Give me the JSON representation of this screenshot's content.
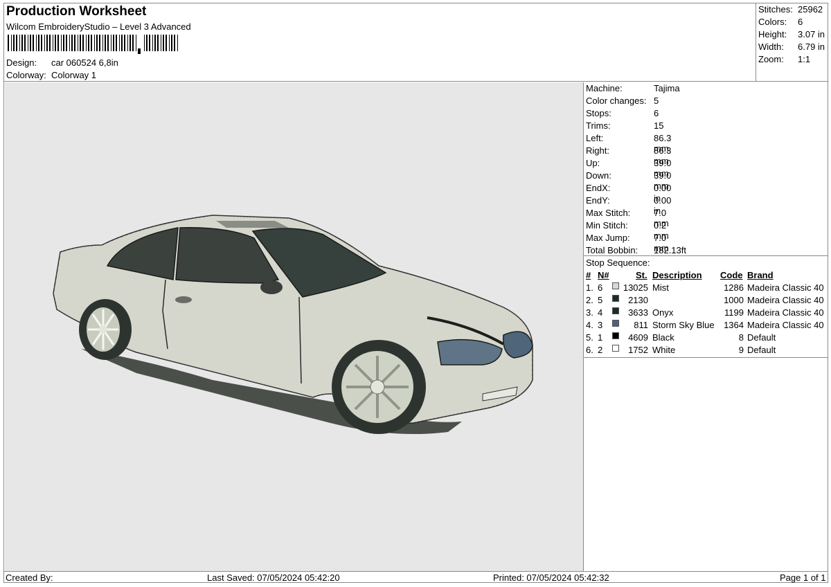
{
  "header": {
    "title": "Production Worksheet",
    "subtitle": "Wilcom EmbroideryStudio – Level 3 Advanced",
    "design_label": "Design:",
    "design_value": "car 060524 6,8in",
    "colorway_label": "Colorway:",
    "colorway_value": "Colorway 1"
  },
  "stats": {
    "stitches_label": "Stitches:",
    "stitches": "25962",
    "colors_label": "Colors:",
    "colors": "6",
    "height_label": "Height:",
    "height": "3.07 in",
    "width_label": "Width:",
    "width": "6.79 in",
    "zoom_label": "Zoom:",
    "zoom": "1:1"
  },
  "machine_info": [
    {
      "label": "Machine:",
      "value": "Tajima"
    },
    {
      "label": "Color changes:",
      "value": "5"
    },
    {
      "label": "Stops:",
      "value": "6"
    },
    {
      "label": "Trims:",
      "value": "15"
    },
    {
      "label": "Left:",
      "value": "86.3 mm"
    },
    {
      "label": "Right:",
      "value": "86.3 mm"
    },
    {
      "label": "Up:",
      "value": "39.0 mm"
    },
    {
      "label": "Down:",
      "value": "39.0 mm"
    },
    {
      "label": "EndX:",
      "value": "0.00 in"
    },
    {
      "label": "EndY:",
      "value": "0.00 in"
    },
    {
      "label": "Max Stitch:",
      "value": "7.0 mm"
    },
    {
      "label": "Min Stitch:",
      "value": "0.2 mm"
    },
    {
      "label": "Max Jump:",
      "value": "7.0 mm"
    },
    {
      "label": "Total Bobbin:",
      "value": "182.13ft"
    }
  ],
  "stop_sequence": {
    "title": "Stop Sequence:",
    "headers": {
      "num": "#",
      "n": "N#",
      "st": "St.",
      "desc": "Description",
      "code": "Code",
      "brand": "Brand"
    },
    "rows": [
      {
        "num": "1.",
        "n": "6",
        "st": "13025",
        "color": "#d8d8d6",
        "desc": "Mist",
        "code": "1286",
        "brand": "Madeira Classic 40"
      },
      {
        "num": "2.",
        "n": "5",
        "st": "2130",
        "color": "#1f2b27",
        "desc": "",
        "code": "1000",
        "brand": "Madeira Classic 40"
      },
      {
        "num": "3.",
        "n": "4",
        "st": "3633",
        "color": "#1e2a2c",
        "desc": "Onyx",
        "code": "1199",
        "brand": "Madeira Classic 40"
      },
      {
        "num": "4.",
        "n": "3",
        "st": "811",
        "color": "#4d6282",
        "desc": "Storm Sky Blue",
        "code": "1364",
        "brand": "Madeira Classic 40"
      },
      {
        "num": "5.",
        "n": "1",
        "st": "4609",
        "color": "#000000",
        "desc": "Black",
        "code": "8",
        "brand": "Default"
      },
      {
        "num": "6.",
        "n": "2",
        "st": "1752",
        "color": "#ffffff",
        "desc": "White",
        "code": "9",
        "brand": "Default"
      }
    ]
  },
  "footer": {
    "created_by": "Created By:",
    "last_saved": "Last Saved: 07/05/2024 05:42:20",
    "printed": "Printed: 07/05/2024 05:42:32",
    "page": "Page 1 of 1"
  }
}
